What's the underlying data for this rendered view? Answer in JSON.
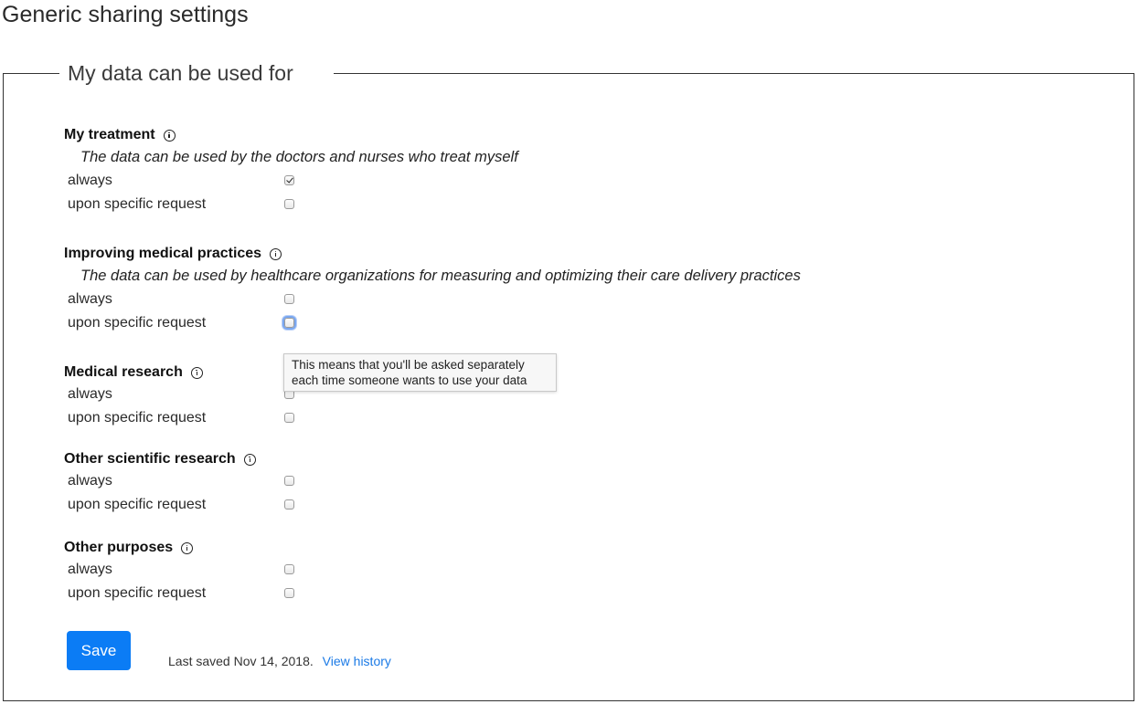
{
  "page": {
    "title": "Generic sharing settings"
  },
  "fieldset": {
    "legend": "My data can be used for"
  },
  "options": {
    "always_label": "always",
    "request_label": "upon specific request"
  },
  "sections": [
    {
      "title": "My treatment",
      "description": "The data can be used by the doctors and nurses who treat myself",
      "always_checked": true,
      "request_checked": false
    },
    {
      "title": "Improving medical practices",
      "description": "The data can be used by healthcare organizations for measuring and optimizing their care delivery practices",
      "always_checked": false,
      "request_checked": false
    },
    {
      "title": "Medical research",
      "description": "",
      "always_checked": false,
      "request_checked": false
    },
    {
      "title": "Other scientific research",
      "description": "",
      "always_checked": false,
      "request_checked": false
    },
    {
      "title": "Other purposes",
      "description": "",
      "always_checked": false,
      "request_checked": false
    }
  ],
  "tooltip": {
    "line1": "This means that you'll be asked separately",
    "line2": "each time someone wants to use your data"
  },
  "footer": {
    "save_label": "Save",
    "status_text": "Last saved Nov 14, 2018.",
    "history_link": "View history"
  },
  "colors": {
    "primary_button": "#0b7cf5",
    "link": "#1b7ae6",
    "focus_ring": "#7aa7f0"
  },
  "icons": {
    "info": "info-circle-icon",
    "checkmark": "checkmark-icon"
  }
}
